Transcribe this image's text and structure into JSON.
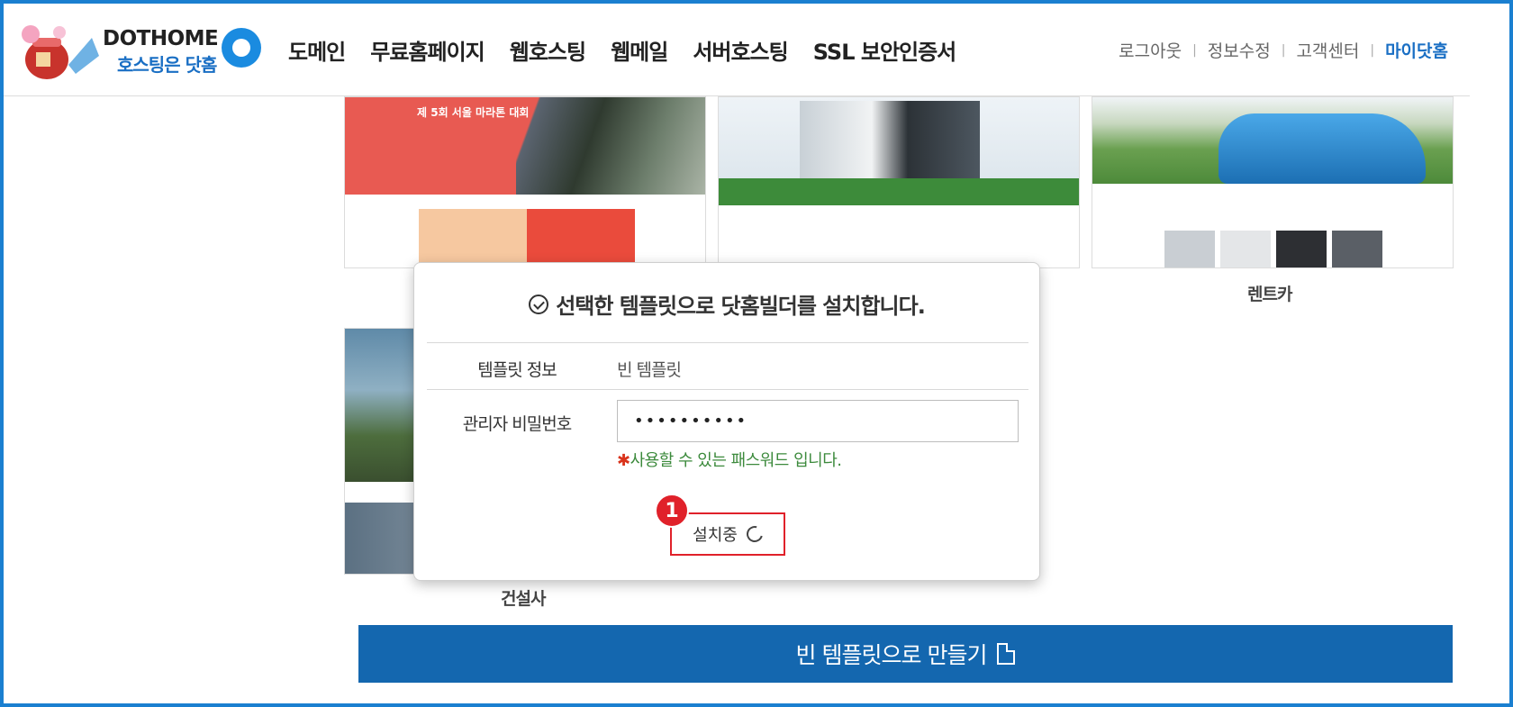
{
  "logo": {
    "wordmark": "DOTHOME",
    "tagline": "호스팅은 닷홈"
  },
  "nav": {
    "main": [
      "도메인",
      "무료홈페이지",
      "웹호스팅",
      "웹메일",
      "서버호스팅",
      "SSL 보안인증서"
    ],
    "util": {
      "logout": "로그아웃",
      "edit_profile": "정보수정",
      "support": "고객센터",
      "my_dothome": "마이닷홈"
    }
  },
  "templates": {
    "marathon_title": "제 5회 서울 마라톤 대회",
    "rentcar_label": "렌트카",
    "construction_label": "건설사"
  },
  "blank_template_button": "빈 템플릿으로 만들기",
  "modal": {
    "title": "선택한 템플릿으로 닷홈빌더를 설치합니다.",
    "template_info_label": "템플릿 정보",
    "template_info_value": "빈 템플릿",
    "admin_password_label": "관리자 비밀번호",
    "admin_password_value": "••••••••••",
    "password_message_star": "✱",
    "password_message": "사용할 수 있는 패스워드 입니다.",
    "install_button": "설치중",
    "step_badge": "1"
  },
  "colors": {
    "frame": "#1a7fd0",
    "primary": "#1467af",
    "highlight": "#e0212a",
    "ok_text": "#3c8a3c"
  }
}
